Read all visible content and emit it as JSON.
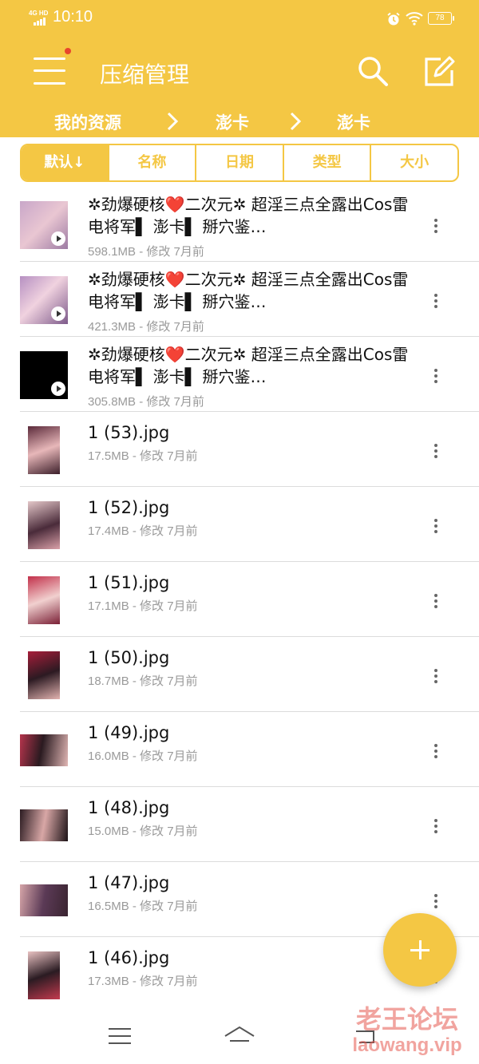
{
  "status_bar": {
    "network": "4G HD",
    "time": "10:10",
    "battery": "78"
  },
  "header": {
    "title": "压缩管理"
  },
  "breadcrumb": {
    "items": [
      "我的资源",
      "澎卡",
      "澎卡"
    ]
  },
  "sort_tabs": [
    {
      "label": "默认↓",
      "active": true
    },
    {
      "label": "名称",
      "active": false
    },
    {
      "label": "日期",
      "active": false
    },
    {
      "label": "类型",
      "active": false
    },
    {
      "label": "大小",
      "active": false
    }
  ],
  "files": [
    {
      "name": "✲劲爆硬核❤️二次元✲ 超淫三点全露出Cos雷电将军▌ 澎卡▌ 掰穴鉴…",
      "meta": "598.1MB - 修改 7月前",
      "kind": "video"
    },
    {
      "name": "✲劲爆硬核❤️二次元✲ 超淫三点全露出Cos雷电将军▌ 澎卡▌ 掰穴鉴…",
      "meta": "421.3MB - 修改 7月前",
      "kind": "video"
    },
    {
      "name": "✲劲爆硬核❤️二次元✲ 超淫三点全露出Cos雷电将军▌ 澎卡▌ 掰穴鉴…",
      "meta": "305.8MB - 修改 7月前",
      "kind": "video-black"
    },
    {
      "name": "1 (53).jpg",
      "meta": "17.5MB - 修改 7月前",
      "kind": "image"
    },
    {
      "name": "1 (52).jpg",
      "meta": "17.4MB - 修改 7月前",
      "kind": "image"
    },
    {
      "name": "1 (51).jpg",
      "meta": "17.1MB - 修改 7月前",
      "kind": "image"
    },
    {
      "name": "1 (50).jpg",
      "meta": "18.7MB - 修改 7月前",
      "kind": "image"
    },
    {
      "name": "1 (49).jpg",
      "meta": "16.0MB - 修改 7月前",
      "kind": "image-wide"
    },
    {
      "name": "1 (48).jpg",
      "meta": "15.0MB - 修改 7月前",
      "kind": "image-wide"
    },
    {
      "name": "1 (47).jpg",
      "meta": "16.5MB - 修改 7月前",
      "kind": "image-wide"
    },
    {
      "name": "1 (46).jpg",
      "meta": "17.3MB - 修改 7月前",
      "kind": "image"
    }
  ],
  "watermark": {
    "line1": "老王论坛",
    "line2": "laowang.vip"
  },
  "colors": {
    "accent": "#f4c744",
    "notification_dot": "#e8452c"
  },
  "icons": [
    "menu-icon",
    "search-icon",
    "edit-icon",
    "chevron-right-icon",
    "play-icon",
    "more-vert-icon",
    "add-icon",
    "nav-menu-icon",
    "nav-home-icon",
    "nav-back-icon"
  ]
}
